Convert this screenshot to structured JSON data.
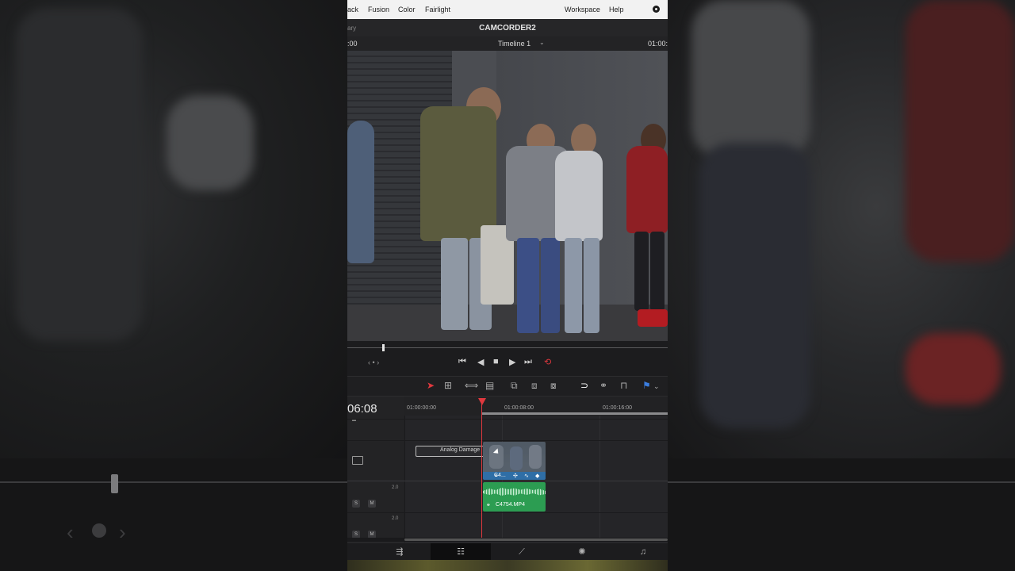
{
  "menu": {
    "items": [
      "ack",
      "Fusion",
      "Color",
      "Fairlight"
    ],
    "workspace": "Workspace",
    "help": "Help"
  },
  "title_bar": {
    "library_fragment": "ary",
    "project_name": "CAMCORDER2"
  },
  "viewer_bar": {
    "timecode_left": ":00",
    "timeline_name": "Timeline 1",
    "timecode_right": "01:00:"
  },
  "transport": {
    "jog_left": "‹",
    "jog_dot": "•",
    "jog_right": "›",
    "buttons": [
      "go-to-start",
      "play-reverse",
      "stop",
      "play",
      "go-to-end",
      "loop"
    ]
  },
  "toolbar": {
    "tools": [
      "selection",
      "trim",
      "dynamic-trim",
      "blade",
      "insert",
      "overwrite",
      "replace",
      "snapping",
      "linked-selection",
      "lock",
      "flag"
    ]
  },
  "timeline": {
    "timecode": "06:08",
    "ruler_ticks": [
      "01:00:00:00",
      "01:00:08:00",
      "01:00:16:00"
    ],
    "title_clip": "Analog Damage",
    "video_clip": "C4...",
    "audio_clip": "C4754.MP4",
    "audio_tracks": [
      {
        "channels": "2.0",
        "solo": "S",
        "mute": "M"
      },
      {
        "channels": "2.0",
        "solo": "S",
        "mute": "M"
      }
    ]
  },
  "pages": [
    "Cut",
    "Edit",
    "Fusion",
    "Color",
    "Fairlight"
  ],
  "active_page": "Edit",
  "colors": {
    "accent_red": "#e0383e",
    "video_clip_blue": "#2f6ea6",
    "audio_clip_green": "#2c9d52",
    "ui_dark": "#1c1c1e"
  }
}
